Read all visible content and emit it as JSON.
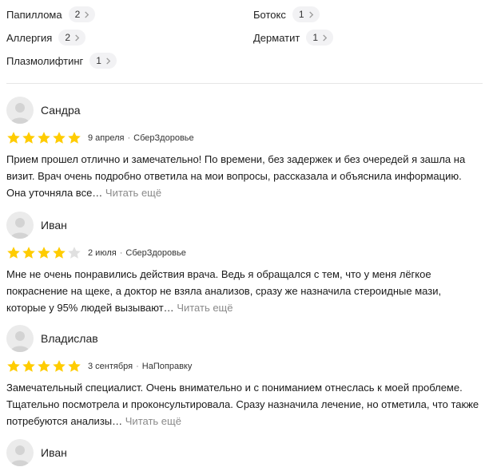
{
  "tags": [
    {
      "label": "Папиллома",
      "count": "2"
    },
    {
      "label": "Ботокс",
      "count": "1"
    },
    {
      "label": "Аллергия",
      "count": "2"
    },
    {
      "label": "Дерматит",
      "count": "1"
    },
    {
      "label": "Плазмолифтинг",
      "count": "1"
    }
  ],
  "colors": {
    "star_filled": "#ffcc00",
    "star_empty": "#e0e0e0",
    "read_more": "#8a8a8a"
  },
  "reviews": [
    {
      "author": "Сандра",
      "rating": 5,
      "date": "9 апреля",
      "source": "СберЗдоровье",
      "text": "Прием прошел отлично и замечательно! По времени, без задержек и без очередей я зашла на визит. Врач очень подробно ответила на мои вопросы, рассказала и объяснила информацию. Она уточняла все…",
      "read_more": "Читать ещё"
    },
    {
      "author": "Иван",
      "rating": 4,
      "date": "2 июля",
      "source": "СберЗдоровье",
      "text": "Мне не очень понравились действия врача. Ведь я обращался с тем, что у меня лёгкое покраснение на щеке, а доктор не взяла анализов, сразу же назначила стероидные мази, которые у 95% людей вызывают…",
      "read_more": "Читать ещё"
    },
    {
      "author": "Владислав",
      "rating": 5,
      "date": "3 сентября",
      "source": "НаПоправку",
      "text": "Замечательный специалист. Очень внимательно и с пониманием отнеслась к моей проблеме. Тщательно посмотрела и проконсультировала. Сразу назначила лечение, но отметила, что также потребуются анализы…",
      "read_more": "Читать ещё"
    },
    {
      "author": "Иван",
      "rating": null,
      "date": "",
      "source": "",
      "text": "",
      "read_more": ""
    }
  ]
}
